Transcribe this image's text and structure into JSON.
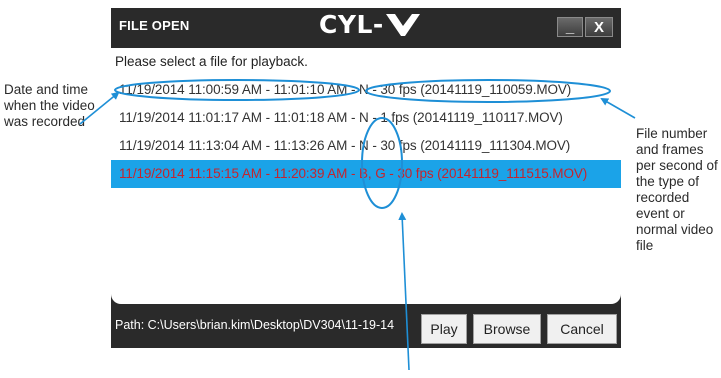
{
  "annotations": {
    "left": "Date and time when the video was recorded",
    "right": "File number and frames per second of the type of recorded event or normal video file"
  },
  "dialog": {
    "title": "FILE OPEN",
    "logo": "CYL-",
    "minimize_label": "_",
    "close_label": "X",
    "prompt": "Please select a file for playback.",
    "files": [
      "11/19/2014 11:00:59 AM - 11:01:10 AM - N - 30 fps (20141119_110059.MOV)",
      "11/19/2014 11:01:17 AM - 11:01:18 AM - N - 1 fps (20141119_110117.MOV)",
      "11/19/2014 11:13:04 AM - 11:13:26 AM - N - 30 fps (20141119_111304.MOV)",
      "11/19/2014 11:15:15 AM - 11:20:39 AM - B, G - 30 fps (20141119_111515.MOV)"
    ],
    "selected_index": 3,
    "path": "Path:  C:\\Users\\brian.kim\\Desktop\\DV304\\11-19-14",
    "buttons": {
      "play": "Play",
      "browse": "Browse",
      "cancel": "Cancel"
    }
  },
  "colors": {
    "selection_bg": "#1ba3e8",
    "selection_text": "#c3252e",
    "annotation_blue": "#1e8fd6",
    "dialog_bg": "#2a2a2a"
  }
}
